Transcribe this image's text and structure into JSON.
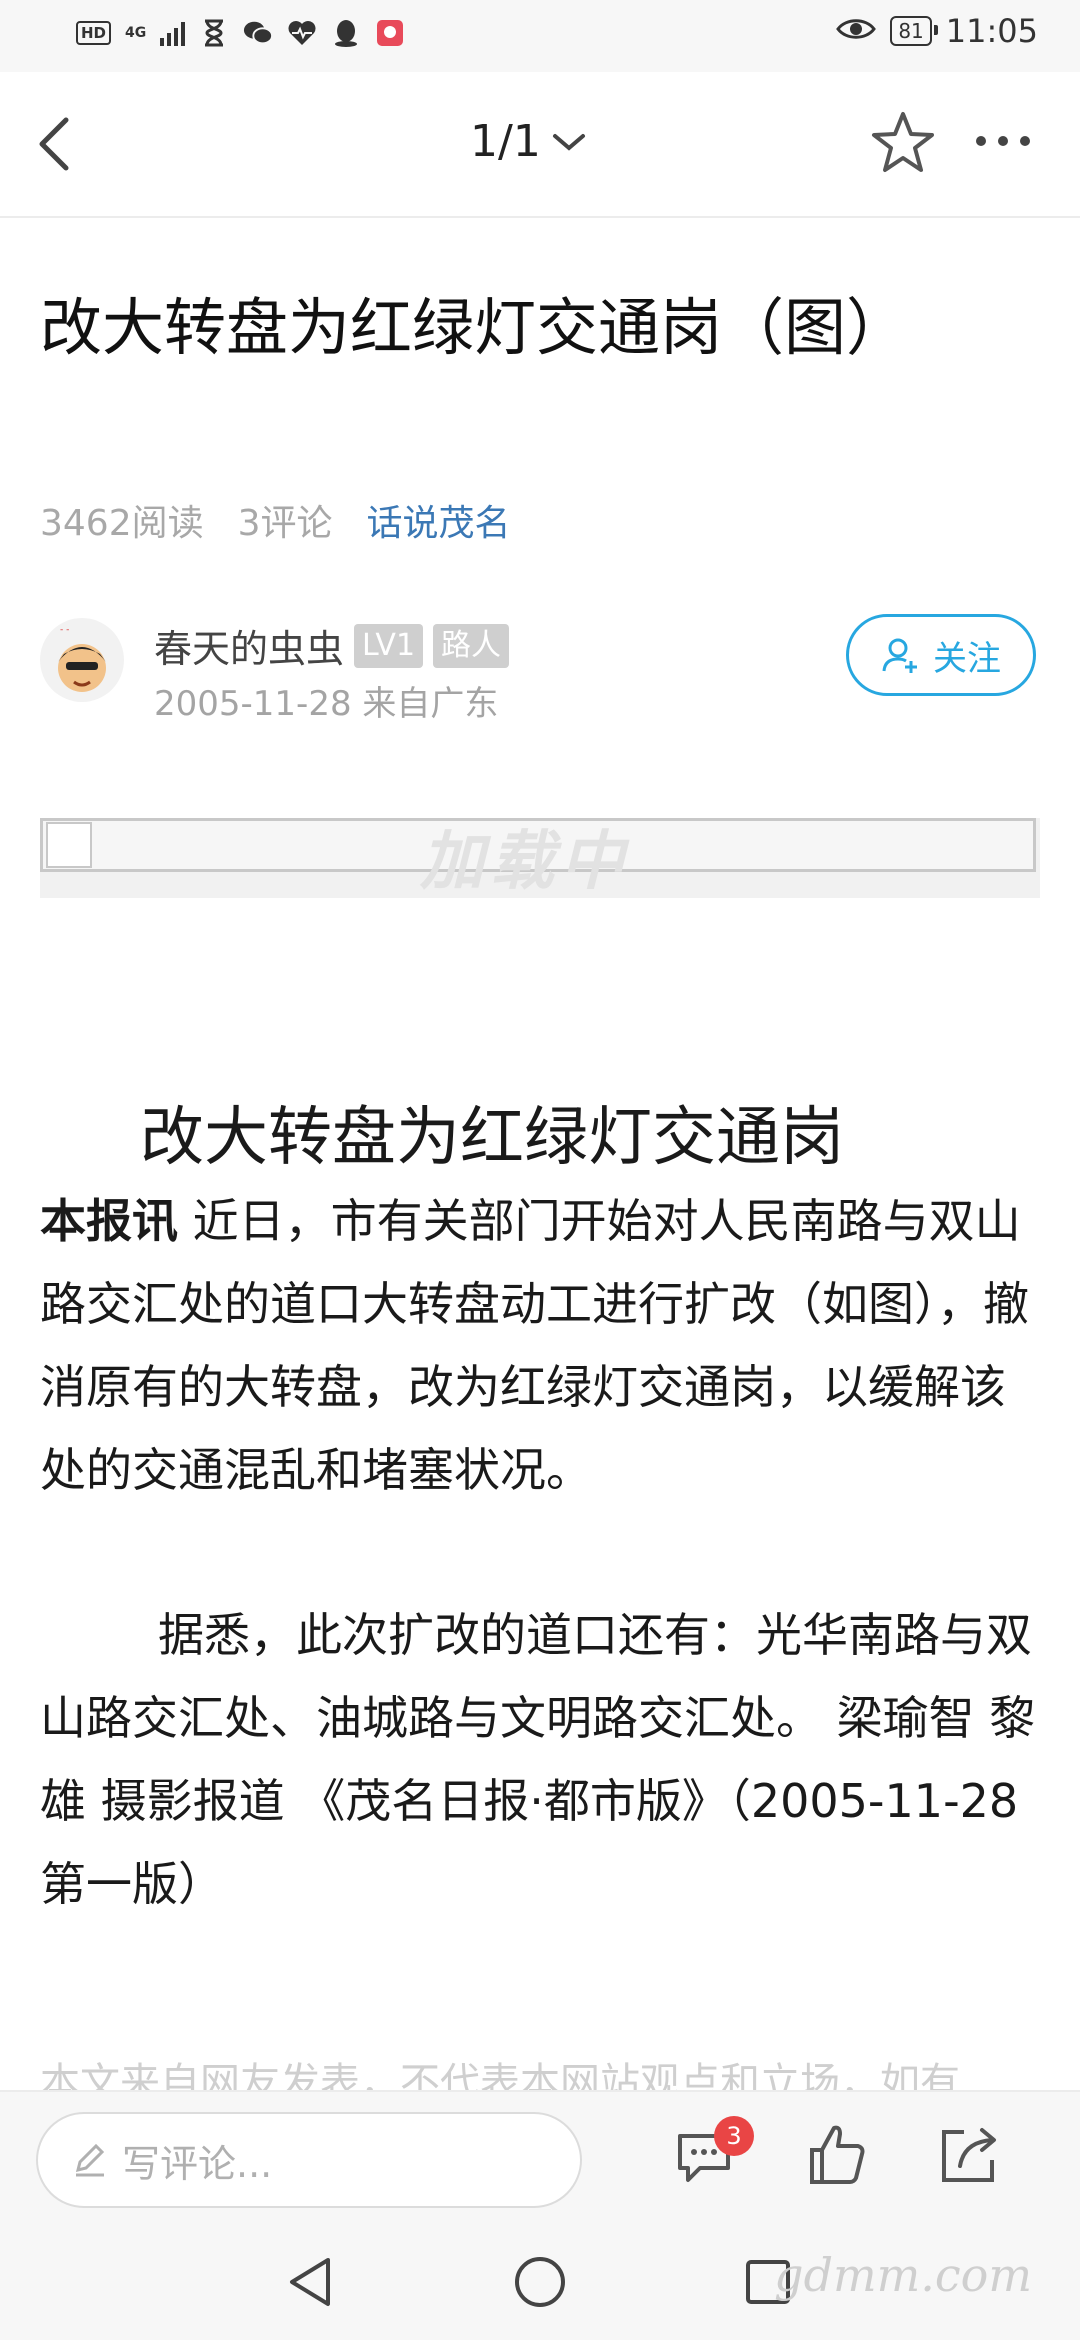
{
  "status_bar": {
    "hd": "HD",
    "network": "4G",
    "battery": "81",
    "time": "11:05"
  },
  "nav": {
    "page_indicator": "1/1"
  },
  "article": {
    "title": "改大转盘为红绿灯交通岗（图）",
    "reads": "3462阅读",
    "comments": "3评论",
    "category": "话说茂名",
    "author": {
      "name": "春天的虫虫",
      "level": "LV1",
      "role": "路人",
      "date_location": "2005-11-28  来自广东"
    },
    "follow_label": "关注",
    "loading_text": "加载中",
    "body_title": "改大转盘为红绿灯交通岗",
    "lead": "本报讯",
    "paragraph1": " 近日，市有关部门开始对人民南路与双山路交汇处的道口大转盘动工进行扩改（如图），撤消原有的大转盘，改为红绿灯交通岗，以缓解该处的交通混乱和堵塞状况。",
    "paragraph2": "据悉，此次扩改的道口还有：光华南路与双山路交汇处、油城路与文明路交汇处。 梁瑜智 黎雄 摄影报道 《茂名日报·都市版》（2005-11-28 第一版）",
    "disclaimer": "本文来自网友发表，不代表本网站观点和立场，如有"
  },
  "bottom_bar": {
    "comment_placeholder": "写评论...",
    "comment_count": "3"
  },
  "watermark": "gdmm.com",
  "colors": {
    "accent": "#27a7e0",
    "category": "#3b78b5",
    "badge": "#e94545"
  }
}
